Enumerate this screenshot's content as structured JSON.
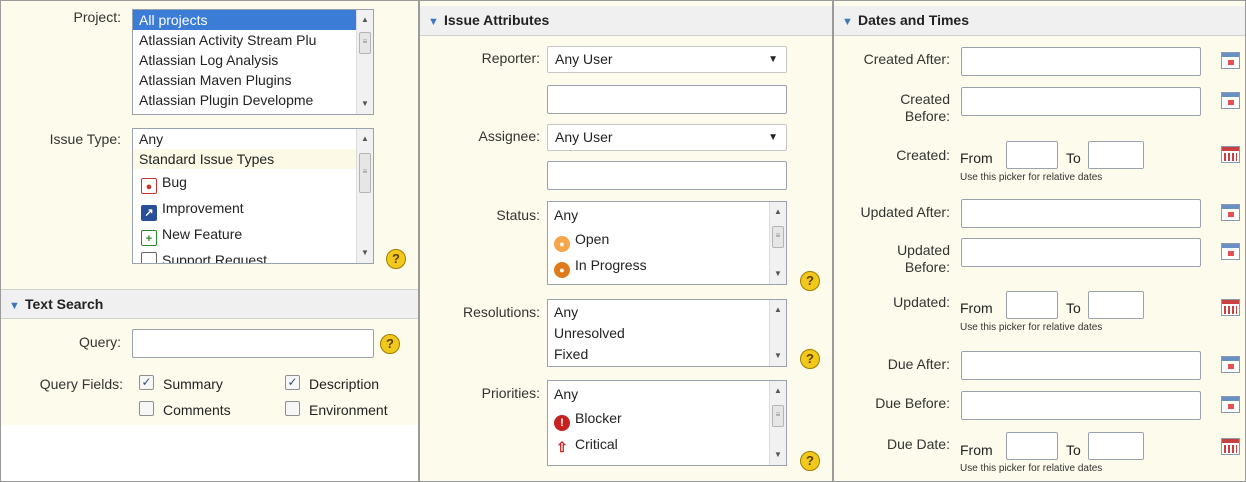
{
  "filters": {
    "project": {
      "label": "Project:",
      "options": [
        "All projects",
        "Atlassian Activity Stream Plu",
        "Atlassian Log Analysis",
        "Atlassian Maven Plugins",
        "Atlassian Plugin Developme"
      ]
    },
    "issue_type": {
      "label": "Issue Type:",
      "options": [
        "Any",
        "Standard Issue Types",
        "Bug",
        "Improvement",
        "New Feature",
        "Support Request"
      ]
    }
  },
  "text_search": {
    "title": "Text Search",
    "query_label": "Query:",
    "query_value": "",
    "fields_label": "Query Fields:",
    "fields": [
      {
        "label": "Summary",
        "checked": true
      },
      {
        "label": "Description",
        "checked": true
      },
      {
        "label": "Comments",
        "checked": false
      },
      {
        "label": "Environment",
        "checked": false
      }
    ]
  },
  "issue_attributes": {
    "title": "Issue Attributes",
    "reporter_label": "Reporter:",
    "reporter_value": "Any User",
    "assignee_label": "Assignee:",
    "assignee_value": "Any User",
    "status_label": "Status:",
    "status_options": [
      "Any",
      "Open",
      "In Progress"
    ],
    "resolutions_label": "Resolutions:",
    "resolution_options": [
      "Any",
      "Unresolved",
      "Fixed"
    ],
    "priorities_label": "Priorities:",
    "priority_options": [
      "Any",
      "Blocker",
      "Critical"
    ]
  },
  "dates": {
    "title": "Dates and Times",
    "created_after": "Created After:",
    "created_before_1": "Created",
    "created_before_2": "Before:",
    "created": "Created:",
    "updated_after": "Updated After:",
    "updated_before_1": "Updated",
    "updated_before_2": "Before:",
    "updated": "Updated:",
    "due_after": "Due After:",
    "due_before": "Due Before:",
    "due_date": "Due Date:",
    "from": "From",
    "to": "To",
    "hint": "Use this picker for relative dates"
  },
  "help_glyph": "?"
}
